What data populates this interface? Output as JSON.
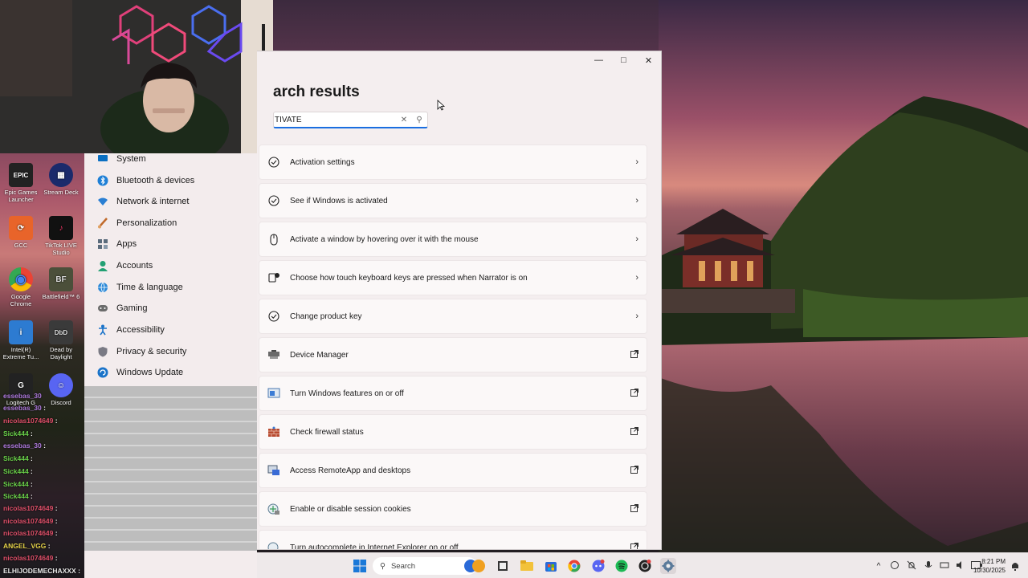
{
  "window": {
    "title": "arch results",
    "search_value": "TIVATE",
    "controls": {
      "minimize": "—",
      "maximize": "□",
      "close": "✕"
    }
  },
  "results": [
    {
      "label": "Activation settings",
      "icon": "check-circle-icon",
      "action": "chevron"
    },
    {
      "label": "See if Windows is activated",
      "icon": "check-circle-icon",
      "action": "chevron"
    },
    {
      "label": "Activate a window by hovering over it with the mouse",
      "icon": "mouse-icon",
      "action": "chevron"
    },
    {
      "label": "Choose how touch keyboard keys are pressed when Narrator is on",
      "icon": "narrator-icon",
      "action": "chevron"
    },
    {
      "label": "Change product key",
      "icon": "check-circle-icon",
      "action": "chevron"
    },
    {
      "label": "Device Manager",
      "icon": "device-manager-icon",
      "action": "external"
    },
    {
      "label": "Turn Windows features on or off",
      "icon": "windows-features-icon",
      "action": "external"
    },
    {
      "label": "Check firewall status",
      "icon": "firewall-icon",
      "action": "external"
    },
    {
      "label": "Access RemoteApp and desktops",
      "icon": "remoteapp-icon",
      "action": "external"
    },
    {
      "label": "Enable or disable session cookies",
      "icon": "cookies-icon",
      "action": "external"
    },
    {
      "label": "Turn autocomplete in Internet Explorer on or off",
      "icon": "ie-icon",
      "action": "external"
    }
  ],
  "nav": [
    {
      "label": "System",
      "icon": "system-icon",
      "color": "#0a6fc2"
    },
    {
      "label": "Bluetooth & devices",
      "icon": "bluetooth-icon",
      "color": "#1e7fd6"
    },
    {
      "label": "Network & internet",
      "icon": "wifi-icon",
      "color": "#2a7fd3"
    },
    {
      "label": "Personalization",
      "icon": "brush-icon",
      "color": "#c0692a"
    },
    {
      "label": "Apps",
      "icon": "apps-icon",
      "color": "#5a6b7c"
    },
    {
      "label": "Accounts",
      "icon": "person-icon",
      "color": "#22a073"
    },
    {
      "label": "Time & language",
      "icon": "globe-icon",
      "color": "#2a88d8"
    },
    {
      "label": "Gaming",
      "icon": "gamepad-icon",
      "color": "#6b6b6b"
    },
    {
      "label": "Accessibility",
      "icon": "accessibility-icon",
      "color": "#1a73c9"
    },
    {
      "label": "Privacy & security",
      "icon": "shield-icon",
      "color": "#7a7a84"
    },
    {
      "label": "Windows Update",
      "icon": "update-icon",
      "color": "#1a73c9"
    }
  ],
  "desktop_icons": [
    {
      "label": "Epic Games Launcher",
      "color": "#222222",
      "glyph": "EPIC"
    },
    {
      "label": "Stream Deck",
      "color": "#1b2a6b",
      "glyph": "▦"
    },
    {
      "label": "GCC",
      "color": "#e8642a",
      "glyph": "⟳"
    },
    {
      "label": "TikTok LIVE Studio",
      "color": "#111111",
      "glyph": "♪"
    },
    {
      "label": "Google Chrome",
      "color": "#ffffff",
      "glyph": "◉"
    },
    {
      "label": "Battlefield™ 6",
      "color": "#4b4f3a",
      "glyph": "BF"
    },
    {
      "label": "Intel(R) Extreme Tu...",
      "color": "#2d7bd1",
      "glyph": "i"
    },
    {
      "label": "Dead by Daylight",
      "color": "#3a3a3a",
      "glyph": "DbD"
    },
    {
      "label": "Logitech G",
      "color": "#222222",
      "glyph": "G"
    },
    {
      "label": "Discord",
      "color": "#5865f2",
      "glyph": "☺"
    }
  ],
  "chat": [
    {
      "user": "essebas_30",
      "text": "",
      "color": "#b07be0"
    },
    {
      "user": "essebas_30",
      "text": ":",
      "color": "#b07be0"
    },
    {
      "user": "nicolas1074649",
      "text": ":",
      "color": "#e0506a"
    },
    {
      "user": "Sick444",
      "text": ":",
      "color": "#6bd34a"
    },
    {
      "user": "essebas_30",
      "text": ":",
      "color": "#b07be0"
    },
    {
      "user": "Sick444",
      "text": ":",
      "color": "#6bd34a"
    },
    {
      "user": "Sick444",
      "text": ":",
      "color": "#6bd34a"
    },
    {
      "user": "Sick444",
      "text": ":",
      "color": "#6bd34a"
    },
    {
      "user": "Sick444",
      "text": ":",
      "color": "#6bd34a"
    },
    {
      "user": "nicolas1074649",
      "text": ":",
      "color": "#e0506a"
    },
    {
      "user": "nicolas1074649",
      "text": ":",
      "color": "#e0506a"
    },
    {
      "user": "nicolas1074649",
      "text": ":",
      "color": "#e0506a"
    },
    {
      "user": "ANGEL_VGG",
      "text": ":",
      "color": "#e8d44a"
    },
    {
      "user": "nicolas1074649",
      "text": ":",
      "color": "#e0506a"
    },
    {
      "user": "ELHIJODEMECHAXXX",
      "text": ":",
      "color": "#e8e8e8"
    }
  ],
  "taskbar": {
    "search_label": "Search",
    "time": "8:21 PM",
    "date": "10/30/2025"
  },
  "colors": {
    "accent": "#1a6ee0",
    "window_bg": "#f4eeef",
    "card_bg": "#fbf8f8"
  }
}
